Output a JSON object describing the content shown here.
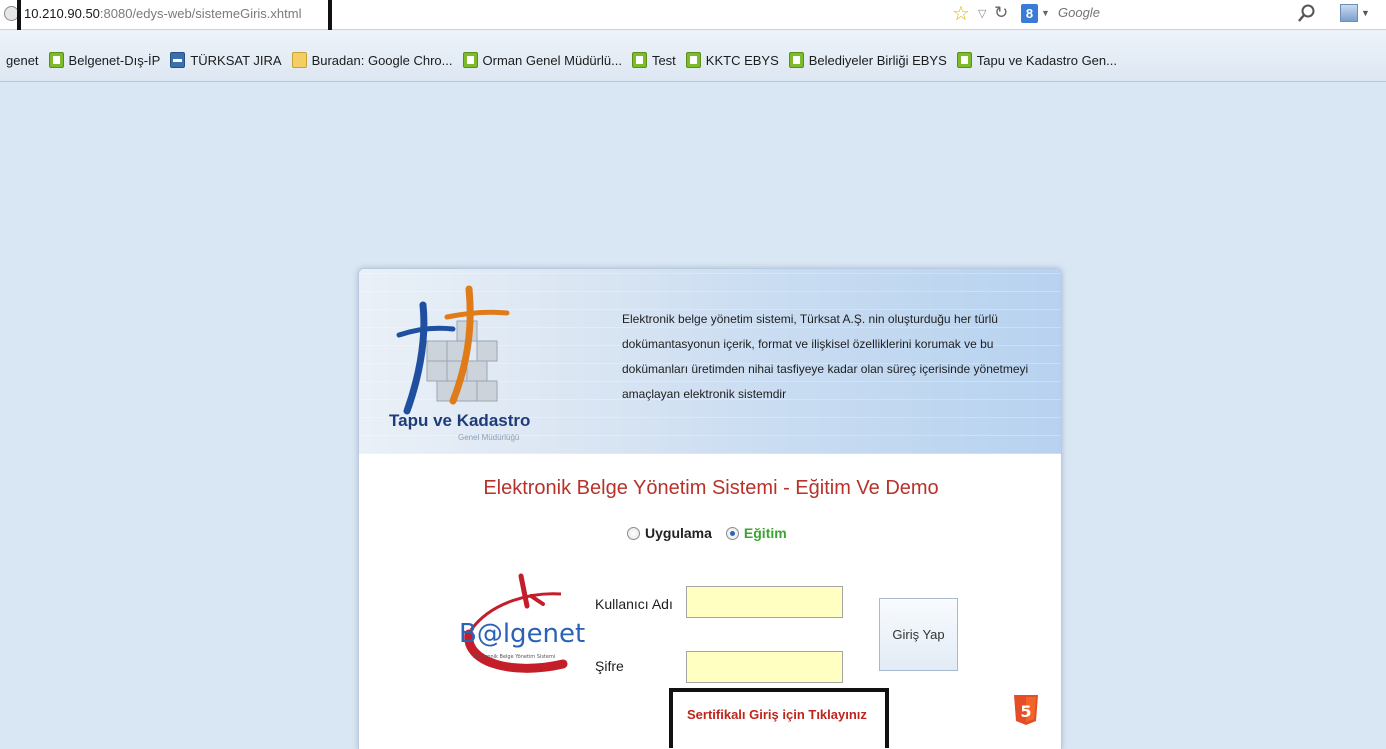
{
  "browser": {
    "url_host": "10.210.90.50",
    "url_rest": ":8080/edys-web/sistemeGiris.xhtml",
    "search_placeholder": "Google",
    "search_engine_letter": "8"
  },
  "bookmarks": [
    {
      "label": "genet",
      "icon": "none"
    },
    {
      "label": "Belgenet-Dış-İP",
      "icon": "page-icon"
    },
    {
      "label": "TÜRKSAT JIRA",
      "icon": "jira-icon"
    },
    {
      "label": "Buradan: Google Chro...",
      "icon": "folder-icon"
    },
    {
      "label": "Orman Genel Müdürlü...",
      "icon": "page-icon"
    },
    {
      "label": "Test",
      "icon": "page-icon"
    },
    {
      "label": "KKTC EBYS",
      "icon": "page-icon"
    },
    {
      "label": "Belediyeler Birliği EBYS",
      "icon": "page-icon"
    },
    {
      "label": "Tapu ve Kadastro Gen...",
      "icon": "page-icon"
    }
  ],
  "header": {
    "org_name": "Tapu ve Kadastro",
    "org_sub": "Genel Müdürlüğü",
    "description": "Elektronik belge yönetim sistemi, Türksat A.Ş. nin oluşturduğu her türlü dokümantasyonun içerik, format ve ilişkisel özelliklerini korumak ve bu dokümanları üretimden nihai tasfiyeye kadar olan süreç içerisinde yönetmeyi amaçlayan elektronik sistemdir"
  },
  "login": {
    "title": "Elektronik Belge Yönetim Sistemi - Eğitim Ve Demo",
    "mode_options": [
      "Uygulama",
      "Eğitim"
    ],
    "selected_mode": "Eğitim",
    "username_label": "Kullanıcı Adı",
    "password_label": "Şifre",
    "username_value": "",
    "password_value": "",
    "submit_label": "Giriş Yap",
    "certificate_link": "Sertifikalı Giriş için Tıklayınız",
    "brand_logo_text": "B@lgenet",
    "brand_logo_tagline": "Elektronik Belge Yönetim Sistemi",
    "badge": "5"
  },
  "colors": {
    "title_red": "#b8322a",
    "link_red": "#c0241c",
    "selected_green": "#3aa52f",
    "field_yellow": "#ffffc2",
    "page_bg": "#d9e6f3"
  }
}
